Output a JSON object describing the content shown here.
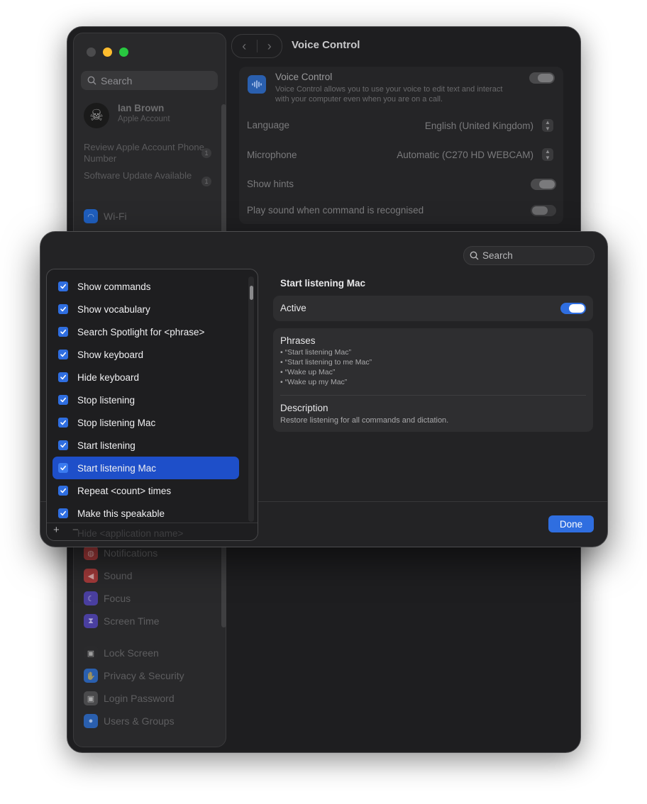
{
  "window": {
    "title": "Voice Control",
    "nav_back": "‹",
    "nav_forward": "›"
  },
  "sidebar": {
    "search_placeholder": "Search",
    "account": {
      "name": "Ian Brown",
      "subtitle": "Apple Account"
    },
    "notices": [
      {
        "label": "Review Apple Account Phone Number",
        "badge": "1"
      },
      {
        "label": "Software Update Available",
        "badge": "1"
      }
    ],
    "items_top": [
      {
        "label": "Wi-Fi",
        "icon": "wifi-icon",
        "color": "#1f5fbf"
      }
    ],
    "items_bottom": [
      {
        "label": "Notifications",
        "icon": "bell-icon",
        "color": "#a33a3a"
      },
      {
        "label": "Sound",
        "icon": "speaker-icon",
        "color": "#a33a3a"
      },
      {
        "label": "Focus",
        "icon": "moon-icon",
        "color": "#4a3fa0"
      },
      {
        "label": "Screen Time",
        "icon": "hourglass-icon",
        "color": "#4a3fa0"
      },
      {
        "label": "Lock Screen",
        "icon": "lock-icon",
        "color": "#2a2a2c"
      },
      {
        "label": "Privacy & Security",
        "icon": "hand-icon",
        "color": "#2a5fae"
      },
      {
        "label": "Login Password",
        "icon": "lock-icon",
        "color": "#4a4a4c"
      },
      {
        "label": "Users & Groups",
        "icon": "users-icon",
        "color": "#2a5fae"
      }
    ]
  },
  "voice_control": {
    "title": "Voice Control",
    "description": "Voice Control allows you to use your voice to edit text and interact with your computer even when you are on a call.",
    "enabled": true,
    "language_label": "Language",
    "language_value": "English (United Kingdom)",
    "microphone_label": "Microphone",
    "microphone_value": "Automatic (C270 HD WEBCAM)",
    "show_hints_label": "Show hints",
    "show_hints": true,
    "play_sound_label": "Play sound when command is recognised",
    "play_sound": false
  },
  "sheet": {
    "search_placeholder": "Search",
    "commands": [
      {
        "label": "Show commands",
        "checked": true
      },
      {
        "label": "Show vocabulary",
        "checked": true
      },
      {
        "label": "Search Spotlight for <phrase>",
        "checked": true
      },
      {
        "label": "Show keyboard",
        "checked": true
      },
      {
        "label": "Hide keyboard",
        "checked": true
      },
      {
        "label": "Stop listening",
        "checked": true
      },
      {
        "label": "Stop listening Mac",
        "checked": true
      },
      {
        "label": "Start listening",
        "checked": true
      },
      {
        "label": "Start listening Mac",
        "checked": true,
        "selected": true
      },
      {
        "label": "Repeat <count> times",
        "checked": true
      },
      {
        "label": "Make this speakable",
        "checked": true
      }
    ],
    "peek_item": "Hide <application name>",
    "add_label": "+",
    "remove_label": "−",
    "detail": {
      "title": "Start listening Mac",
      "active_label": "Active",
      "active": true,
      "phrases_heading": "Phrases",
      "phrases": [
        "• “Start listening Mac”",
        "• “Start listening to me Mac”",
        "• “Wake up Mac”",
        "• “Wake up my Mac”"
      ],
      "description_heading": "Description",
      "description": "Restore listening for all commands and dictation."
    },
    "done_label": "Done"
  },
  "colors": {
    "accent": "#2f6ee0",
    "selection": "#1e4fc9",
    "window_bg": "#1e1e20"
  }
}
